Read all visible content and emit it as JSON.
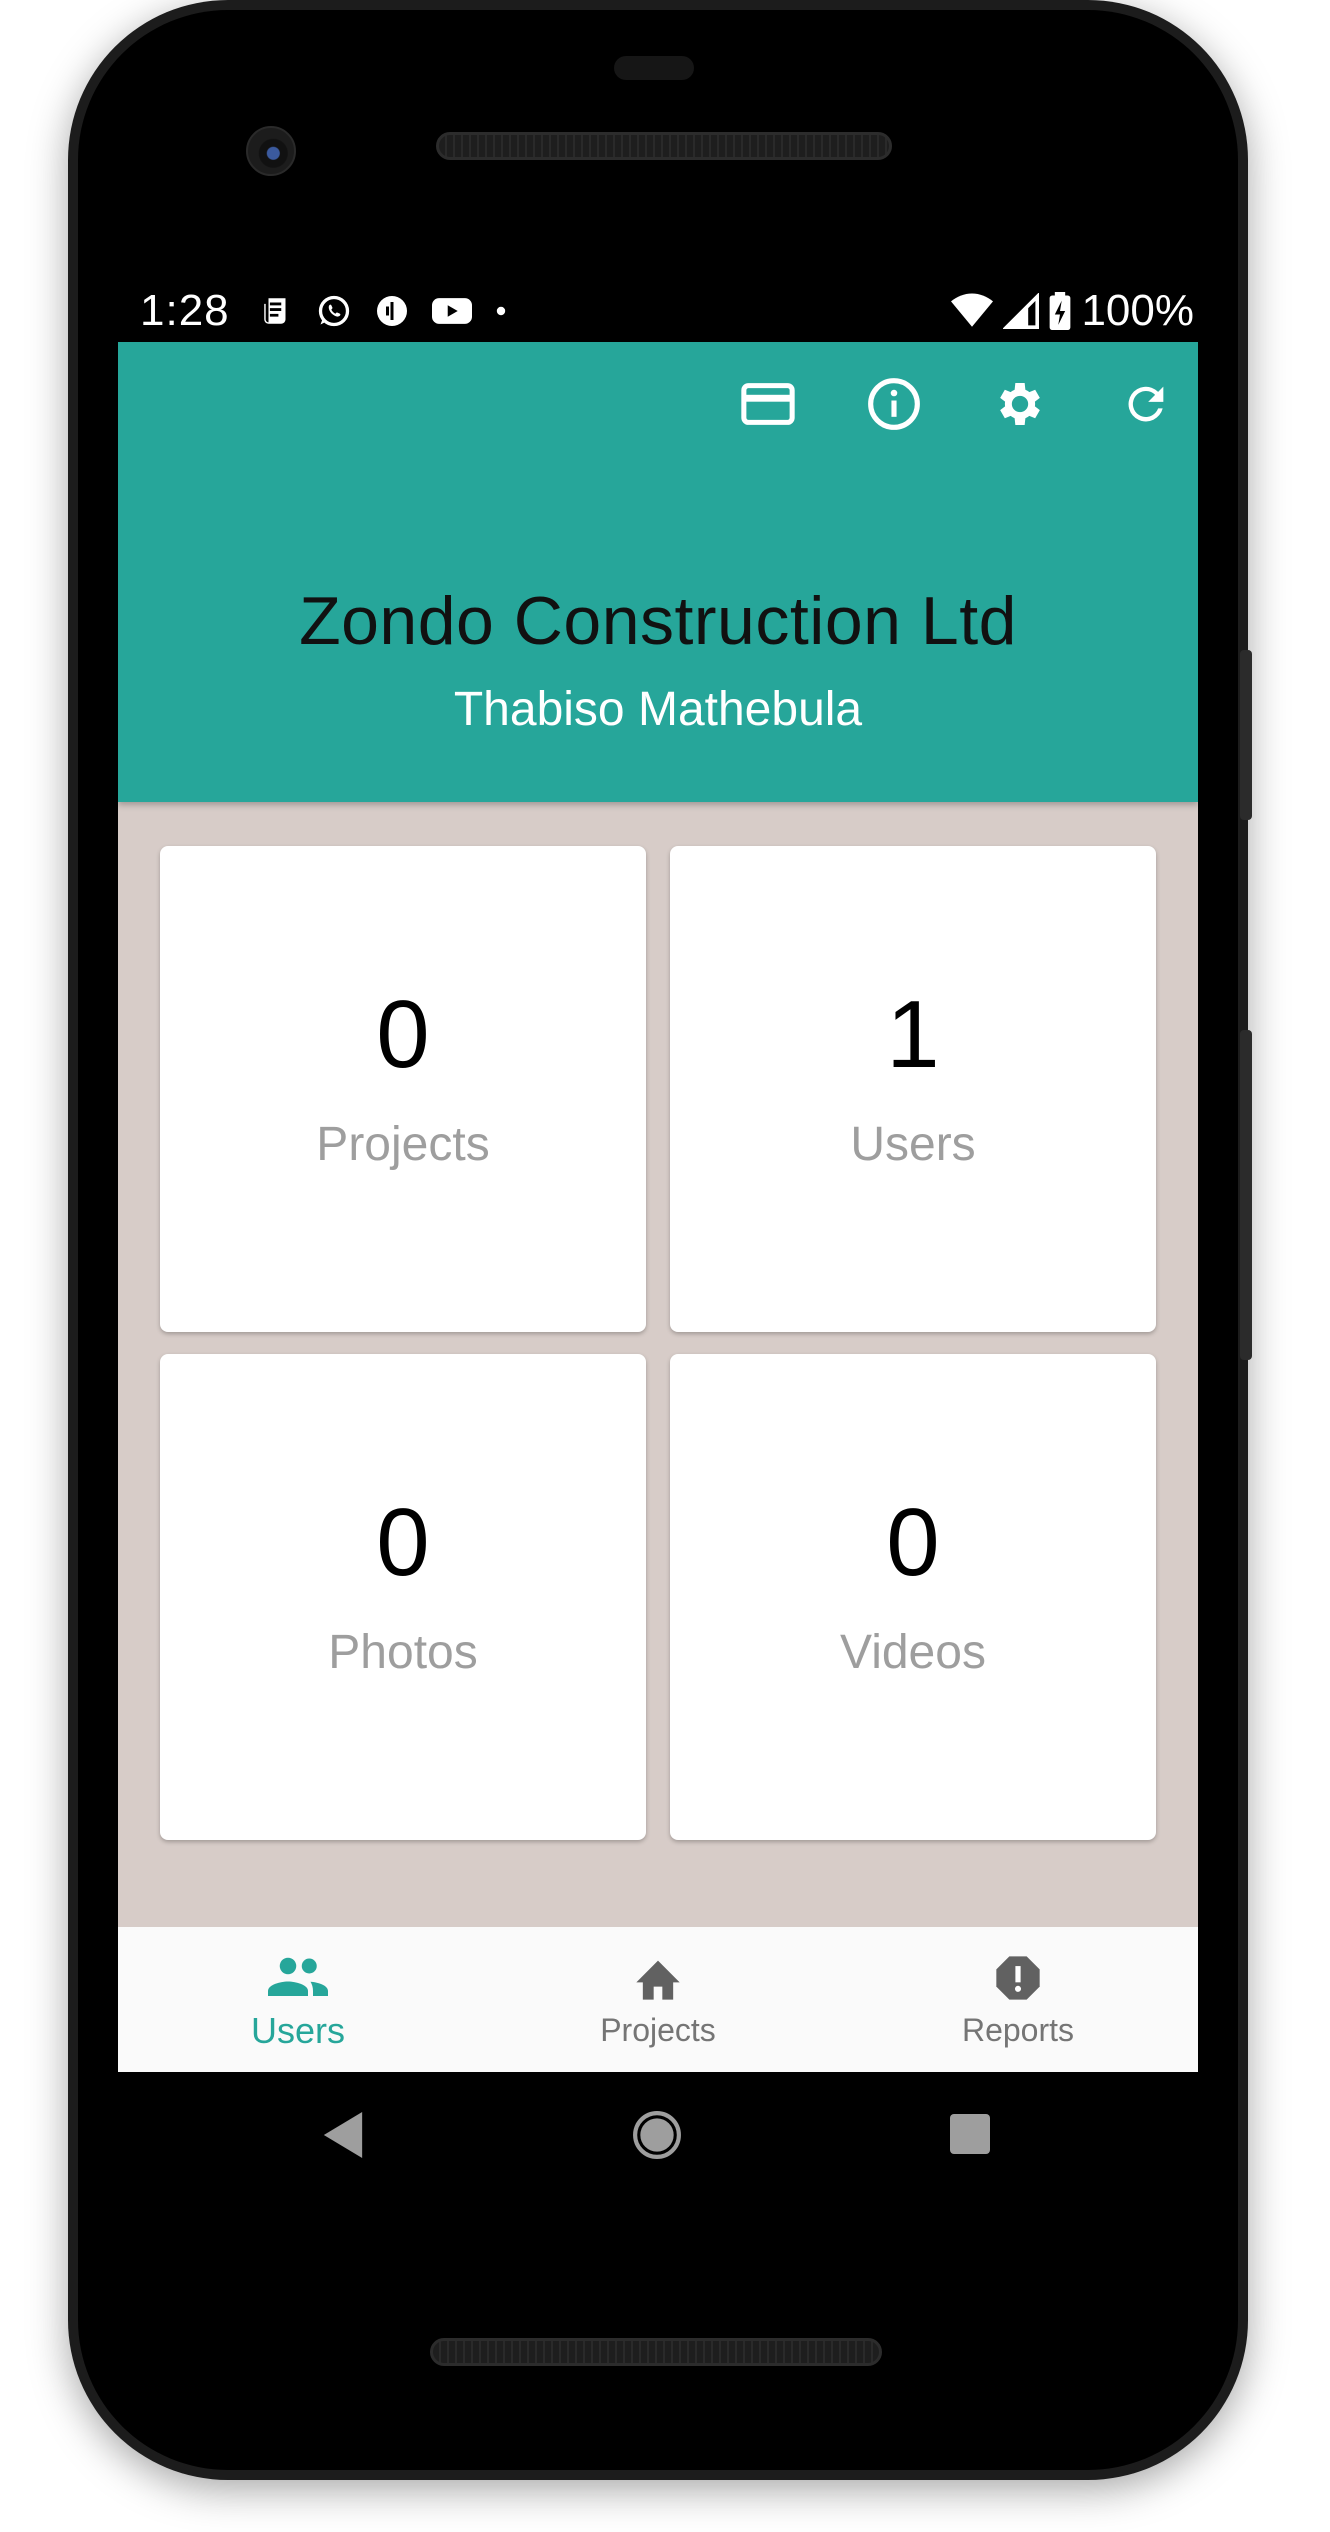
{
  "status_bar": {
    "time": "1:28",
    "battery": "100%",
    "notification_icons": [
      "news-icon",
      "whatsapp-icon",
      "app-icon",
      "youtube-icon",
      "dot-icon"
    ],
    "system_icons": [
      "wifi-icon",
      "signal-icon",
      "battery-charging-icon"
    ]
  },
  "app_bar": {
    "color": "#26a69a",
    "actions": [
      "credit-card-icon",
      "info-icon",
      "settings-icon",
      "refresh-icon"
    ],
    "company": "Zondo Construction Ltd",
    "user_name": "Thabiso Mathebula"
  },
  "stats": [
    {
      "value": "0",
      "label": "Projects"
    },
    {
      "value": "1",
      "label": "Users"
    },
    {
      "value": "0",
      "label": "Photos"
    },
    {
      "value": "0",
      "label": "Videos"
    }
  ],
  "bottom_nav": {
    "items": [
      {
        "label": "Users",
        "icon": "people-icon",
        "active": true
      },
      {
        "label": "Projects",
        "icon": "home-icon",
        "active": false
      },
      {
        "label": "Reports",
        "icon": "report-icon",
        "active": false
      }
    ]
  },
  "system_nav": [
    "back-icon",
    "home-circle-icon",
    "recents-icon"
  ]
}
